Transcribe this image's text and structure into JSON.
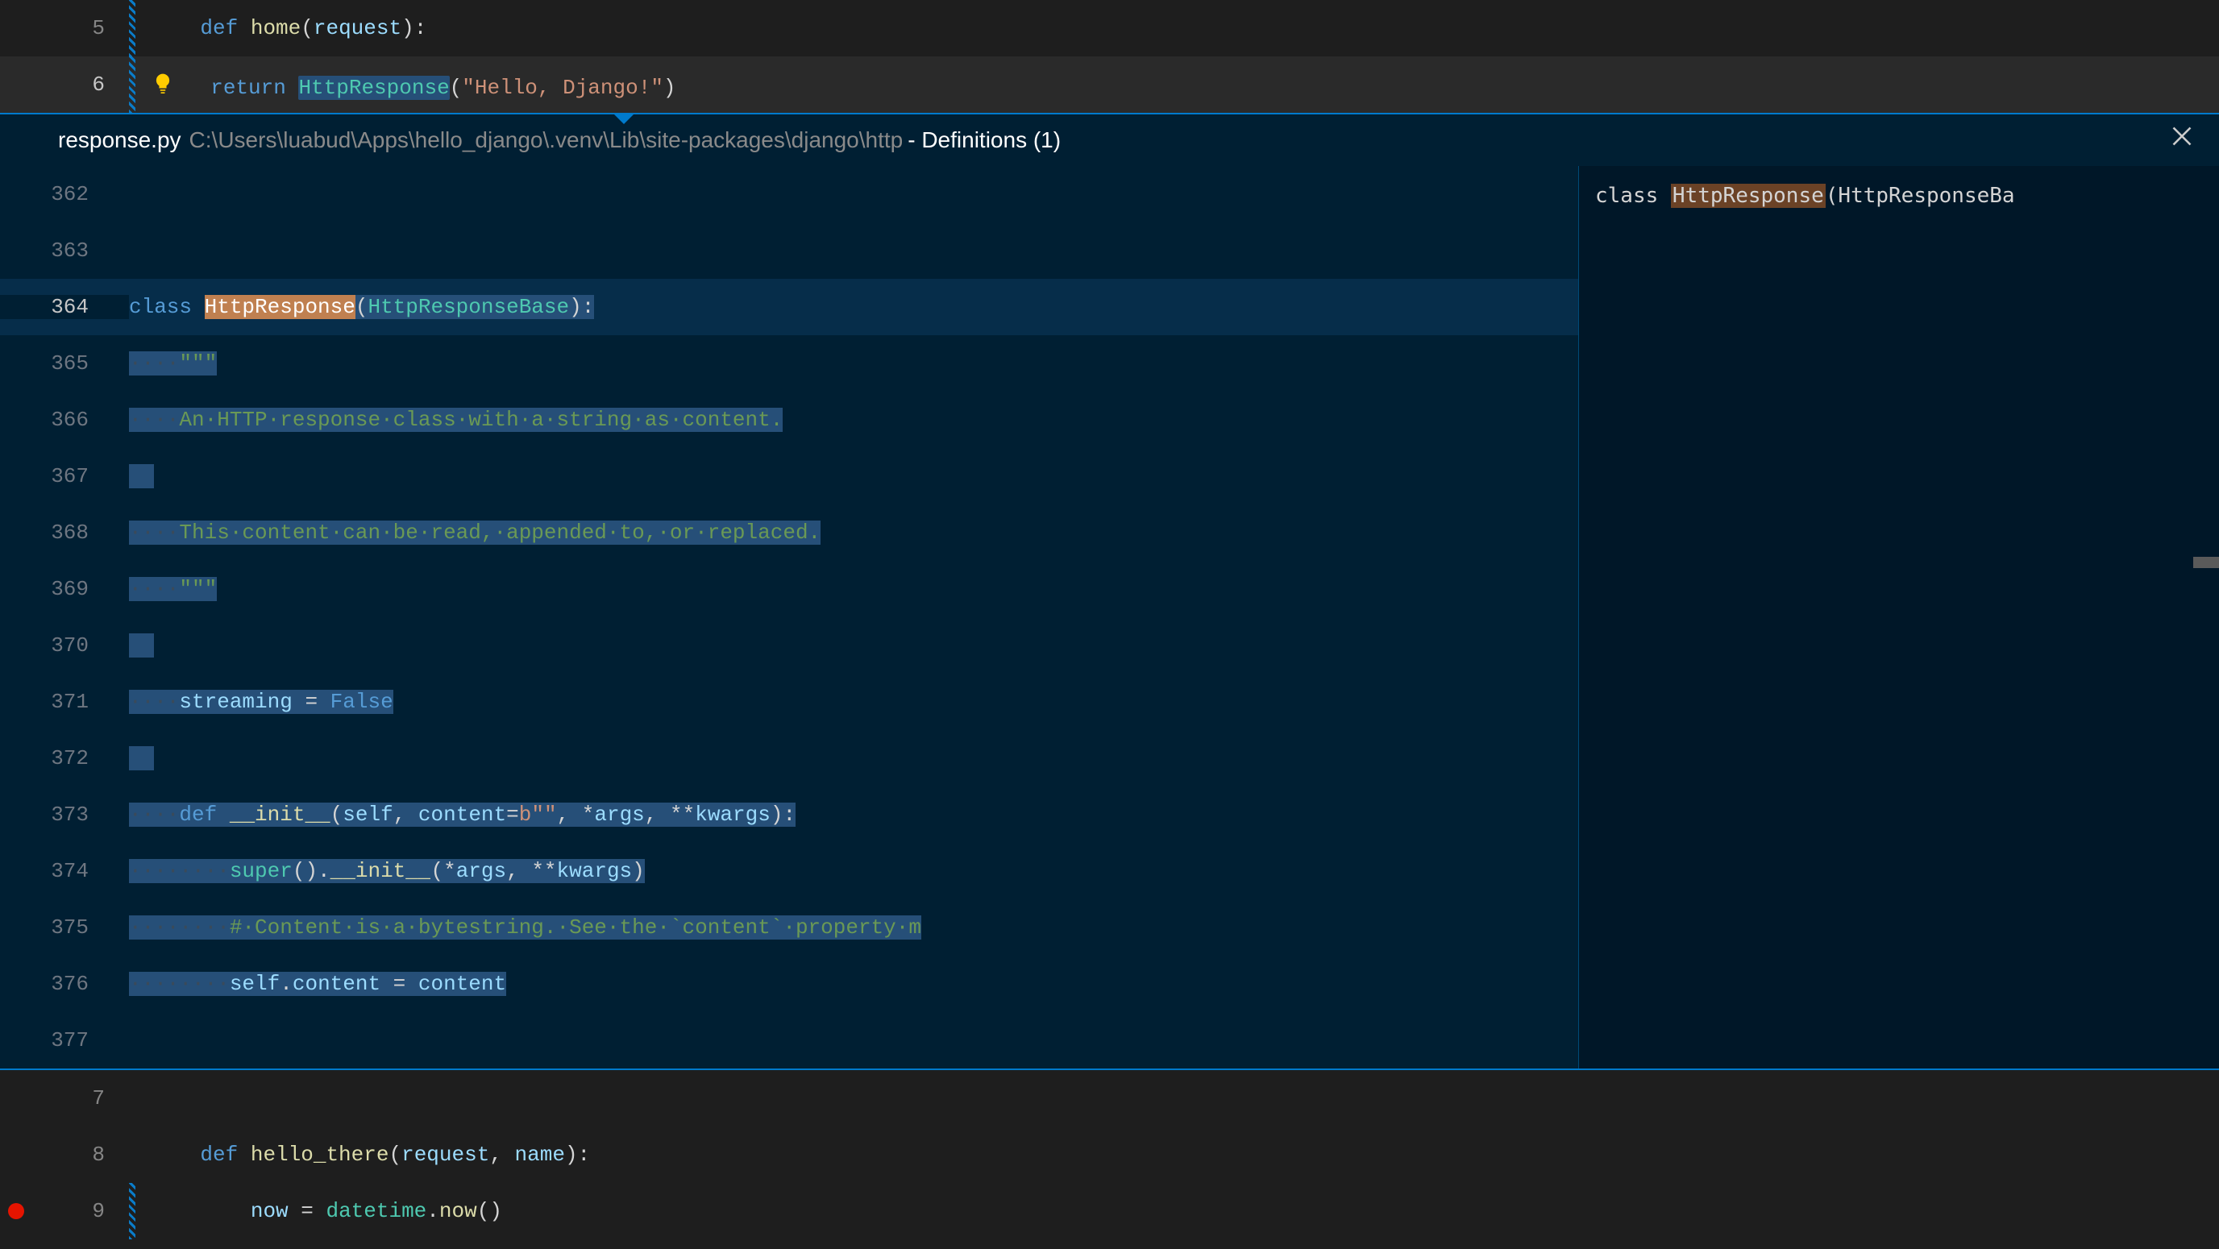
{
  "main_editor": {
    "lines": [
      {
        "num": "5",
        "tokens": [
          {
            "t": "def ",
            "c": "keyword"
          },
          {
            "t": "home",
            "c": "func-name"
          },
          {
            "t": "(",
            "c": "punct"
          },
          {
            "t": "request",
            "c": "param"
          },
          {
            "t": "):",
            "c": "punct"
          }
        ]
      },
      {
        "num": "6",
        "lightbulb": true,
        "highlight_line": true,
        "tokens": [
          {
            "t": "return ",
            "c": "keyword"
          },
          {
            "t": "HttpResponse",
            "c": "class-name",
            "hl": true
          },
          {
            "t": "(",
            "c": "punct"
          },
          {
            "t": "\"Hello, Django!\"",
            "c": "string"
          },
          {
            "t": ")",
            "c": "punct"
          }
        ]
      }
    ],
    "lines_after": [
      {
        "num": "7",
        "tokens": []
      },
      {
        "num": "8",
        "tokens": [
          {
            "t": "def ",
            "c": "keyword"
          },
          {
            "t": "hello_there",
            "c": "func-name"
          },
          {
            "t": "(",
            "c": "punct"
          },
          {
            "t": "request",
            "c": "param"
          },
          {
            "t": ", ",
            "c": "punct"
          },
          {
            "t": "name",
            "c": "param"
          },
          {
            "t": "):",
            "c": "punct"
          }
        ]
      },
      {
        "num": "9",
        "breakpoint": true,
        "tokens": [
          {
            "t": "    ",
            "c": ""
          },
          {
            "t": "now",
            "c": "param"
          },
          {
            "t": " = ",
            "c": "punct"
          },
          {
            "t": "datetime",
            "c": "class-name"
          },
          {
            "t": ".",
            "c": "punct"
          },
          {
            "t": "now",
            "c": "func-name"
          },
          {
            "t": "()",
            "c": "punct"
          }
        ]
      }
    ]
  },
  "peek": {
    "filename": "response.py",
    "path": "C:\\Users\\luabud\\Apps\\hello_django\\.venv\\Lib\\site-packages\\django\\http",
    "def_text": " - Definitions (1)",
    "sidebar_item": {
      "prefix": "class ",
      "highlight": "HttpResponse",
      "suffix": "(HttpResponseBa"
    },
    "lines": [
      {
        "num": "362",
        "ws": 0,
        "tokens": []
      },
      {
        "num": "363",
        "ws": 0,
        "tokens": []
      },
      {
        "num": "364",
        "current": true,
        "ws": 0,
        "tokens": [
          {
            "t": "class ",
            "c": "keyword"
          },
          {
            "t": "HttpResponse",
            "c": "class-name",
            "def": true
          },
          {
            "t": "(",
            "c": "punct",
            "sel": true
          },
          {
            "t": "HttpResponseBase",
            "c": "class-name",
            "sel": true
          },
          {
            "t": "):",
            "c": "punct",
            "sel": true
          }
        ]
      },
      {
        "num": "365",
        "ws": 4,
        "sel": true,
        "tokens": [
          {
            "t": "\"\"\"",
            "c": "comment",
            "sel": true
          }
        ]
      },
      {
        "num": "366",
        "ws": 4,
        "sel": true,
        "tokens": [
          {
            "t": "An HTTP response class with a string as content.",
            "c": "comment",
            "sel": true,
            "dots": true
          }
        ]
      },
      {
        "num": "367",
        "ws": 0,
        "sel": true,
        "tokens": []
      },
      {
        "num": "368",
        "ws": 4,
        "sel": true,
        "tokens": [
          {
            "t": "This content can be read, appended to, or replaced.",
            "c": "comment",
            "sel": true,
            "dots": true
          }
        ]
      },
      {
        "num": "369",
        "ws": 4,
        "sel": true,
        "tokens": [
          {
            "t": "\"\"\"",
            "c": "comment",
            "sel": true
          }
        ]
      },
      {
        "num": "370",
        "ws": 0,
        "sel": true,
        "tokens": []
      },
      {
        "num": "371",
        "ws": 4,
        "sel": true,
        "tokens": [
          {
            "t": "streaming",
            "c": "param",
            "sel": true
          },
          {
            "t": " = ",
            "c": "punct",
            "sel": true
          },
          {
            "t": "False",
            "c": "const",
            "sel": true
          }
        ]
      },
      {
        "num": "372",
        "ws": 0,
        "sel": true,
        "tokens": []
      },
      {
        "num": "373",
        "ws": 4,
        "sel": true,
        "tokens": [
          {
            "t": "def ",
            "c": "keyword",
            "sel": true
          },
          {
            "t": "__init__",
            "c": "func-name",
            "sel": true
          },
          {
            "t": "(",
            "c": "punct",
            "sel": true
          },
          {
            "t": "self",
            "c": "param",
            "sel": true
          },
          {
            "t": ", ",
            "c": "punct",
            "sel": true
          },
          {
            "t": "content",
            "c": "param",
            "sel": true
          },
          {
            "t": "=",
            "c": "punct",
            "sel": true
          },
          {
            "t": "b\"\"",
            "c": "string",
            "sel": true
          },
          {
            "t": ", *",
            "c": "punct",
            "sel": true
          },
          {
            "t": "args",
            "c": "param",
            "sel": true
          },
          {
            "t": ", **",
            "c": "punct",
            "sel": true
          },
          {
            "t": "kwargs",
            "c": "param",
            "sel": true
          },
          {
            "t": "):",
            "c": "punct",
            "sel": true
          }
        ]
      },
      {
        "num": "374",
        "ws": 8,
        "sel": true,
        "tokens": [
          {
            "t": "super",
            "c": "class-name",
            "sel": true
          },
          {
            "t": "().",
            "c": "punct",
            "sel": true
          },
          {
            "t": "__init__",
            "c": "func-name",
            "sel": true
          },
          {
            "t": "(*",
            "c": "punct",
            "sel": true
          },
          {
            "t": "args",
            "c": "param",
            "sel": true
          },
          {
            "t": ", **",
            "c": "punct",
            "sel": true
          },
          {
            "t": "kwargs",
            "c": "param",
            "sel": true
          },
          {
            "t": ")",
            "c": "punct",
            "sel": true
          }
        ]
      },
      {
        "num": "375",
        "ws": 8,
        "sel": true,
        "tokens": [
          {
            "t": "# Content is a bytestring. See the `content` property m",
            "c": "comment",
            "sel": true,
            "dots": true
          }
        ]
      },
      {
        "num": "376",
        "ws": 8,
        "sel": true,
        "tokens": [
          {
            "t": "self",
            "c": "param",
            "sel": true
          },
          {
            "t": ".",
            "c": "punct",
            "sel": true
          },
          {
            "t": "content",
            "c": "param",
            "sel": true
          },
          {
            "t": " = ",
            "c": "punct",
            "sel": true
          },
          {
            "t": "content",
            "c": "param",
            "sel": true
          }
        ]
      },
      {
        "num": "377",
        "ws": 0,
        "tokens": []
      }
    ]
  }
}
